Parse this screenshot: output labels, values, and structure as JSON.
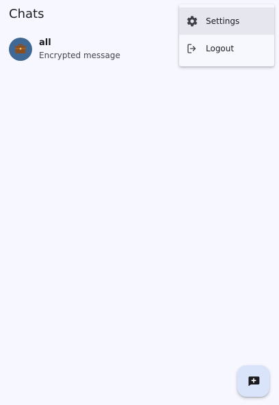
{
  "header": {
    "title": "Chats"
  },
  "chats": [
    {
      "name": "all",
      "preview": "Encrypted message",
      "avatar_icon": "briefcase-icon",
      "avatar_color": "#3f6894"
    }
  ],
  "menu": {
    "items": [
      {
        "label": "Settings",
        "icon": "gear-icon",
        "highlighted": true
      },
      {
        "label": "Logout",
        "icon": "logout-icon",
        "highlighted": false
      }
    ]
  },
  "fab": {
    "icon": "new-chat-icon",
    "background_color": "#d9e4fb"
  },
  "colors": {
    "background": "#f6f7ff",
    "menu_background": "#f7f8fe",
    "menu_highlight": "#e5e6ee",
    "text_primary": "#1b1b1f",
    "text_secondary": "#45464f"
  }
}
